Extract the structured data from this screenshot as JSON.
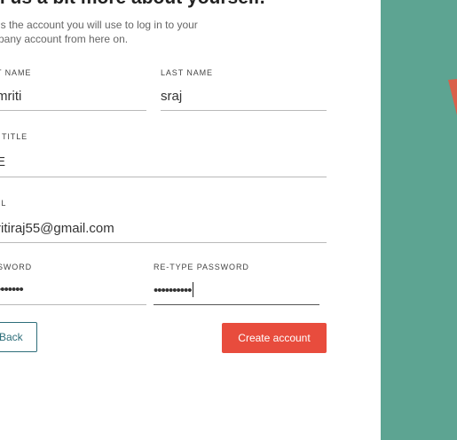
{
  "heading": "ll us a bit more about yourself.",
  "subtitle": "is the account you will use to log in to your pany account from here on.",
  "fields": {
    "first_name": {
      "label": "T NAME",
      "value": "mriti"
    },
    "last_name": {
      "label": "LAST NAME",
      "value": "sraj"
    },
    "job_title": {
      "label": "TITLE",
      "value": "E"
    },
    "email": {
      "label": "IL",
      "value": "ritiraj55@gmail.com"
    },
    "password": {
      "label": "SWORD",
      "value": "•••••••"
    },
    "retype_password": {
      "label": "RE-TYPE PASSWORD",
      "value": "••••••••••"
    }
  },
  "buttons": {
    "back": "Back",
    "create": "Create account"
  },
  "colors": {
    "accent": "#e84c3d",
    "panel": "#5da492",
    "back_border": "#2e6e7a"
  }
}
